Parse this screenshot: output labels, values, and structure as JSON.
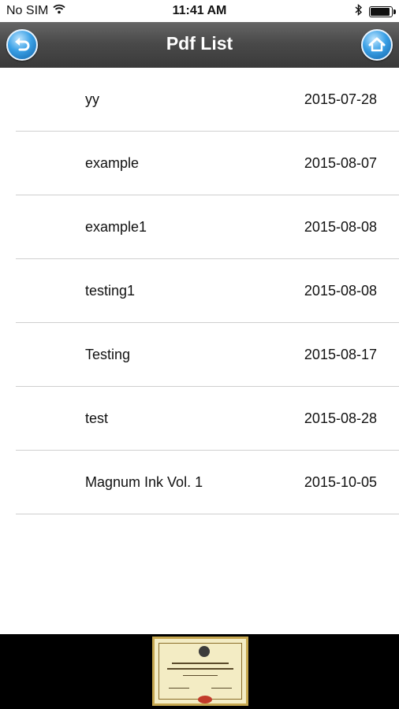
{
  "status_bar": {
    "carrier": "No SIM",
    "time": "11:41 AM",
    "battery_level": 0.85
  },
  "nav": {
    "title": "Pdf List",
    "back_icon": "back-arrow-icon",
    "home_icon": "home-icon"
  },
  "pdfs": [
    {
      "name": "yy",
      "date": "2015-07-28"
    },
    {
      "name": "example",
      "date": "2015-08-07"
    },
    {
      "name": "example1",
      "date": "2015-08-08"
    },
    {
      "name": "testing1",
      "date": "2015-08-08"
    },
    {
      "name": "Testing",
      "date": "2015-08-17"
    },
    {
      "name": "test",
      "date": "2015-08-28"
    },
    {
      "name": "Magnum Ink Vol. 1",
      "date": "2015-10-05"
    }
  ],
  "banner": {
    "image": "certificate-ad"
  },
  "colors": {
    "nav_background": "#4a4a4a",
    "button_blue": "#3aa0e6",
    "divider": "#cfcfcf"
  }
}
